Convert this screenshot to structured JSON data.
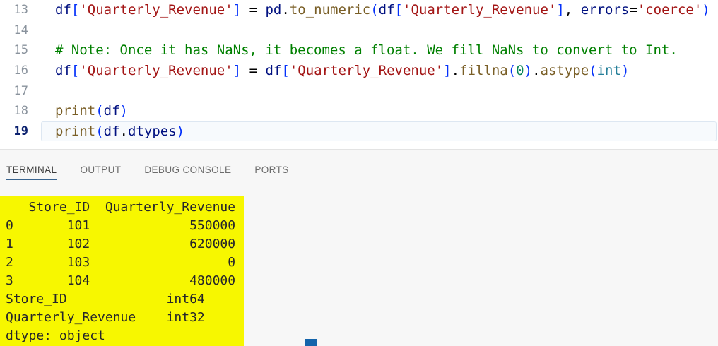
{
  "colors": {
    "tab_active_underline": "#39648f",
    "terminal_highlight": "#f7f700",
    "cursor_block": "#1464ab"
  },
  "editor": {
    "lines": [
      {
        "num": "13",
        "active": false,
        "segments": [
          {
            "t": "df",
            "c": "var"
          },
          {
            "t": "[",
            "c": "br"
          },
          {
            "t": "'Quarterly_Revenue'",
            "c": "str"
          },
          {
            "t": "]",
            "c": "br"
          },
          {
            "t": " = ",
            "c": "plain"
          },
          {
            "t": "pd",
            "c": "var"
          },
          {
            "t": ".",
            "c": "plain"
          },
          {
            "t": "to_numeric",
            "c": "func"
          },
          {
            "t": "(",
            "c": "br"
          },
          {
            "t": "df",
            "c": "var"
          },
          {
            "t": "[",
            "c": "br"
          },
          {
            "t": "'Quarterly_Revenue'",
            "c": "str"
          },
          {
            "t": "]",
            "c": "br"
          },
          {
            "t": ", ",
            "c": "plain"
          },
          {
            "t": "errors",
            "c": "var"
          },
          {
            "t": "=",
            "c": "plain"
          },
          {
            "t": "'coerce'",
            "c": "str"
          },
          {
            "t": ")",
            "c": "br"
          }
        ]
      },
      {
        "num": "14",
        "active": false,
        "segments": []
      },
      {
        "num": "15",
        "active": false,
        "segments": [
          {
            "t": "# Note: Once it has NaNs, it becomes a float. We fill NaNs to convert to Int.",
            "c": "comment"
          }
        ]
      },
      {
        "num": "16",
        "active": false,
        "segments": [
          {
            "t": "df",
            "c": "var"
          },
          {
            "t": "[",
            "c": "br"
          },
          {
            "t": "'Quarterly_Revenue'",
            "c": "str"
          },
          {
            "t": "]",
            "c": "br"
          },
          {
            "t": " = ",
            "c": "plain"
          },
          {
            "t": "df",
            "c": "var"
          },
          {
            "t": "[",
            "c": "br"
          },
          {
            "t": "'Quarterly_Revenue'",
            "c": "str"
          },
          {
            "t": "]",
            "c": "br"
          },
          {
            "t": ".",
            "c": "plain"
          },
          {
            "t": "fillna",
            "c": "func"
          },
          {
            "t": "(",
            "c": "br"
          },
          {
            "t": "0",
            "c": "num"
          },
          {
            "t": ")",
            "c": "br"
          },
          {
            "t": ".",
            "c": "plain"
          },
          {
            "t": "astype",
            "c": "func"
          },
          {
            "t": "(",
            "c": "br"
          },
          {
            "t": "int",
            "c": "type"
          },
          {
            "t": ")",
            "c": "br"
          }
        ]
      },
      {
        "num": "17",
        "active": false,
        "segments": []
      },
      {
        "num": "18",
        "active": false,
        "segments": [
          {
            "t": "print",
            "c": "func"
          },
          {
            "t": "(",
            "c": "br"
          },
          {
            "t": "df",
            "c": "var"
          },
          {
            "t": ")",
            "c": "br"
          }
        ]
      },
      {
        "num": "19",
        "active": true,
        "segments": [
          {
            "t": "print",
            "c": "func"
          },
          {
            "t": "(",
            "c": "br"
          },
          {
            "t": "df",
            "c": "var"
          },
          {
            "t": ".",
            "c": "plain"
          },
          {
            "t": "dtypes",
            "c": "var"
          },
          {
            "t": ")",
            "c": "br"
          }
        ]
      }
    ]
  },
  "panel": {
    "tabs": [
      {
        "id": "terminal",
        "label": "TERMINAL",
        "active": true
      },
      {
        "id": "output",
        "label": "OUTPUT",
        "active": false
      },
      {
        "id": "debug-console",
        "label": "DEBUG CONSOLE",
        "active": false
      },
      {
        "id": "ports",
        "label": "PORTS",
        "active": false
      }
    ],
    "terminal_lines": [
      "   Store_ID  Quarterly_Revenue",
      "0       101             550000",
      "1       102             620000",
      "2       103                  0",
      "3       104             480000",
      "Store_ID             int64",
      "Quarterly_Revenue    int32",
      "dtype: object"
    ]
  }
}
